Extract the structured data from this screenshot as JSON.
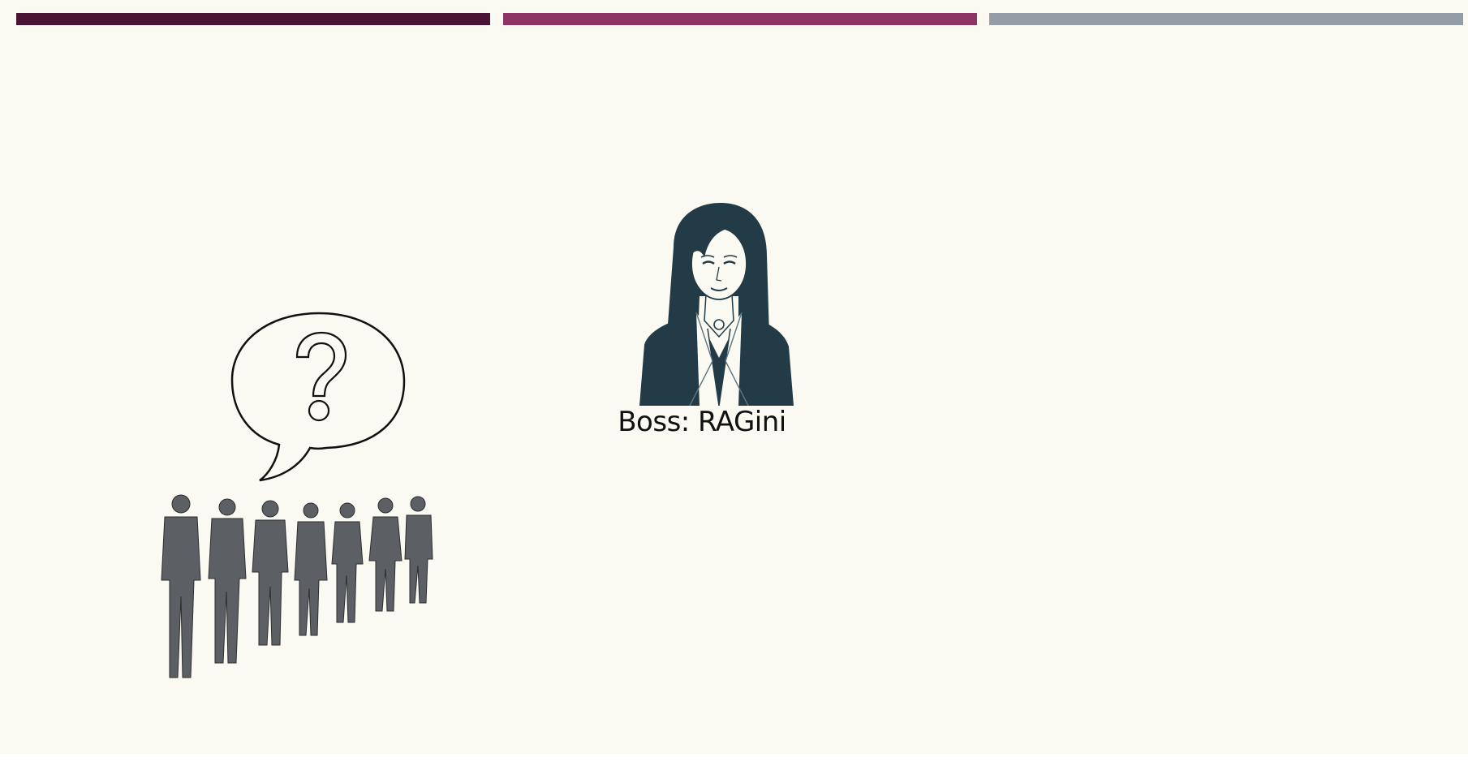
{
  "slide": {
    "top_bars": [
      {
        "color": "#4a1535"
      },
      {
        "color": "#8e3465"
      },
      {
        "color": "#949ca5"
      }
    ],
    "boss": {
      "label": "Boss: RAGini",
      "illustration_icon": "businesswoman-portrait-icon"
    },
    "question_bubble": {
      "icon": "question-mark-icon"
    },
    "queue": {
      "illustration_icon": "people-queue-icon"
    }
  }
}
